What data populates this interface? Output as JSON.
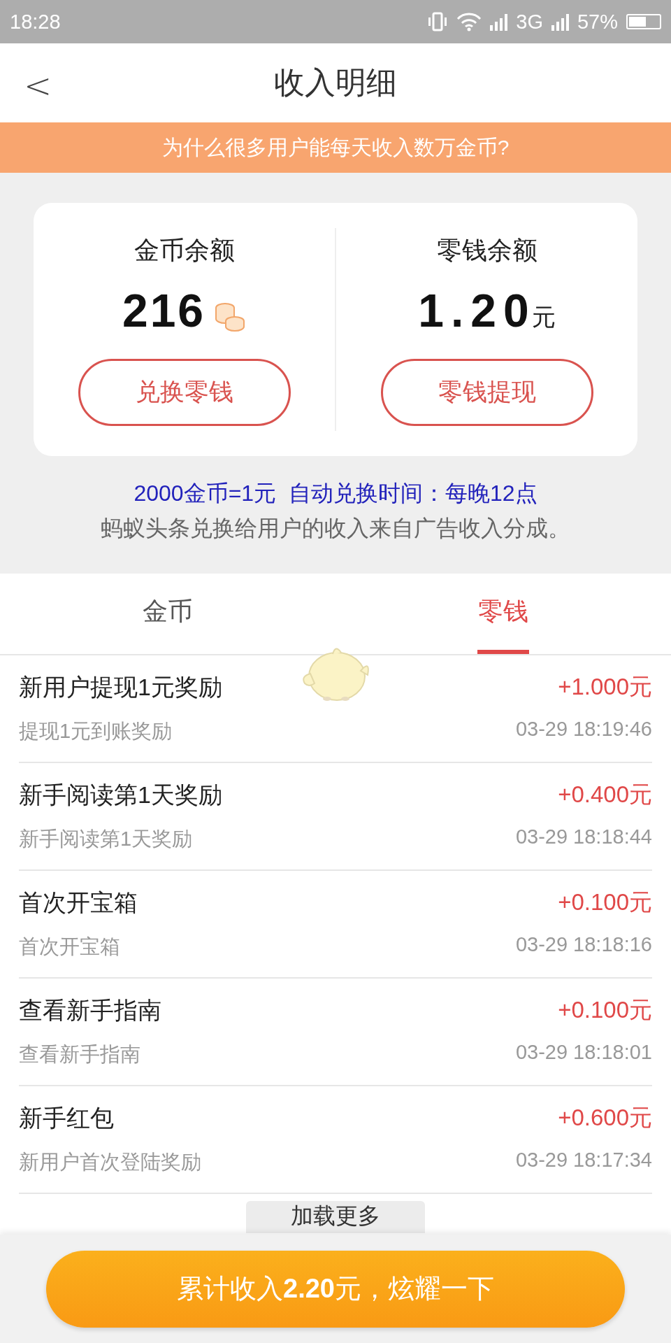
{
  "status_bar": {
    "time": "18:28",
    "network": "3G",
    "battery": "57%"
  },
  "header": {
    "back": "<",
    "title": "收入明细"
  },
  "banner": {
    "text": "为什么很多用户能每天收入数万金币?"
  },
  "balances": [
    {
      "kind": "coins",
      "label": "金币余额",
      "amount": "216",
      "button": "兑换零钱"
    },
    {
      "kind": "money",
      "label": "零钱余额",
      "amount": "1.20",
      "unit": "元",
      "button": "零钱提现"
    }
  ],
  "notes": [
    {
      "kind": "highlight",
      "text": "2000金币=1元  自动兑换时间：每晚12点"
    },
    {
      "kind": "plain",
      "text": "蚂蚁头条兑换给用户的收入来自广告收入分成。"
    }
  ],
  "tabs": [
    {
      "label": "金币",
      "selected": false
    },
    {
      "label": "零钱",
      "selected": true
    }
  ],
  "records": [
    {
      "title": "新用户提现1元奖励",
      "subtitle": "提现1元到账奖励",
      "amount": "+1.000元",
      "time": "03-29 18:19:46"
    },
    {
      "title": "新手阅读第1天奖励",
      "subtitle": "新手阅读第1天奖励",
      "amount": "+0.400元",
      "time": "03-29 18:18:44"
    },
    {
      "title": "首次开宝箱",
      "subtitle": "首次开宝箱",
      "amount": "+0.100元",
      "time": "03-29 18:18:16"
    },
    {
      "title": "查看新手指南",
      "subtitle": "查看新手指南",
      "amount": "+0.100元",
      "time": "03-29 18:18:01"
    },
    {
      "title": "新手红包",
      "subtitle": "新用户首次登陆奖励",
      "amount": "+0.600元",
      "time": "03-29 18:17:34"
    }
  ],
  "load_more": "加载更多",
  "total_button": "累计收入**2.20**元，炫耀一下"
}
